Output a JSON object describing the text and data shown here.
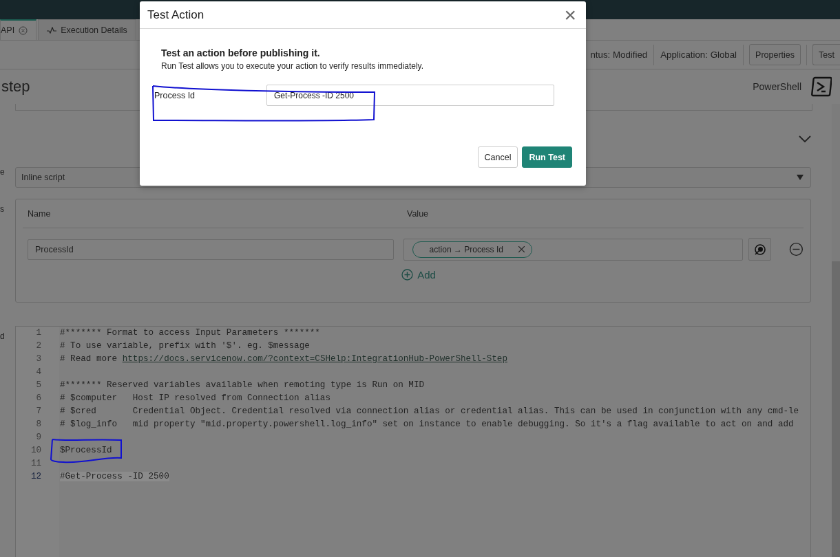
{
  "tabs": [
    {
      "label": "API",
      "selected": true,
      "closable": true
    },
    {
      "label": "Execution Details",
      "selected": false,
      "closable": false
    }
  ],
  "header": {
    "status": "ntus: Modified",
    "application": "Application: Global",
    "buttons": [
      "Properties",
      "Test"
    ]
  },
  "step": {
    "title": "step",
    "type_label": "PowerShell"
  },
  "side_labels": [
    "e",
    "s",
    "d"
  ],
  "script_source": {
    "value": "Inline script"
  },
  "input_variables": {
    "columns": [
      "Name",
      "Value"
    ],
    "rows": [
      {
        "name": "ProcessId",
        "value_pill": "action → Process Id"
      }
    ],
    "add_label": "Add"
  },
  "script": {
    "lines": [
      {
        "number": "1",
        "text": "#******* Format to access Input Parameters *******",
        "active": false
      },
      {
        "number": "2",
        "text": "# To use variable, prefix with '$'. eg. $message",
        "active": false
      },
      {
        "number": "3",
        "text": "# Read more ",
        "link": "https://docs.servicenow.com/?context=CSHelp:IntegrationHub-PowerShell-Step",
        "active": false
      },
      {
        "number": "4",
        "active": false
      },
      {
        "number": "5",
        "text": "#******* Reserved variables available when remoting type is Run on MID",
        "active": false
      },
      {
        "number": "6",
        "text": "# $computer   Host IP resolved from Connection alias",
        "active": false
      },
      {
        "number": "7",
        "text": "# $cred       Credential Object. Credential resolved via connection alias or credential alias. This can be used in conjunction with any cmd-le",
        "active": false
      },
      {
        "number": "8",
        "text": "# $log_info   mid property \"mid.property.powershell.log_info\" set on instance to enable debugging. So it's a flag available to act on and add",
        "active": false
      },
      {
        "number": "9",
        "active": false
      },
      {
        "number": "10",
        "text": "$ProcessId",
        "active": false
      },
      {
        "number": "11",
        "active": false
      },
      {
        "number": "12",
        "text": "#Get-Process -ID 2500",
        "active": true
      }
    ]
  },
  "modal": {
    "title": "Test Action",
    "close": "×",
    "heading": "Test an action before publishing it.",
    "description": "Run Test allows you to execute your action to verify results immediately.",
    "fields": [
      {
        "label": "Process Id",
        "value": "Get-Process -ID 2500"
      }
    ],
    "buttons": [
      {
        "label": "Cancel",
        "kind": "secondary"
      },
      {
        "label": "Run Test",
        "kind": "primary"
      }
    ]
  }
}
